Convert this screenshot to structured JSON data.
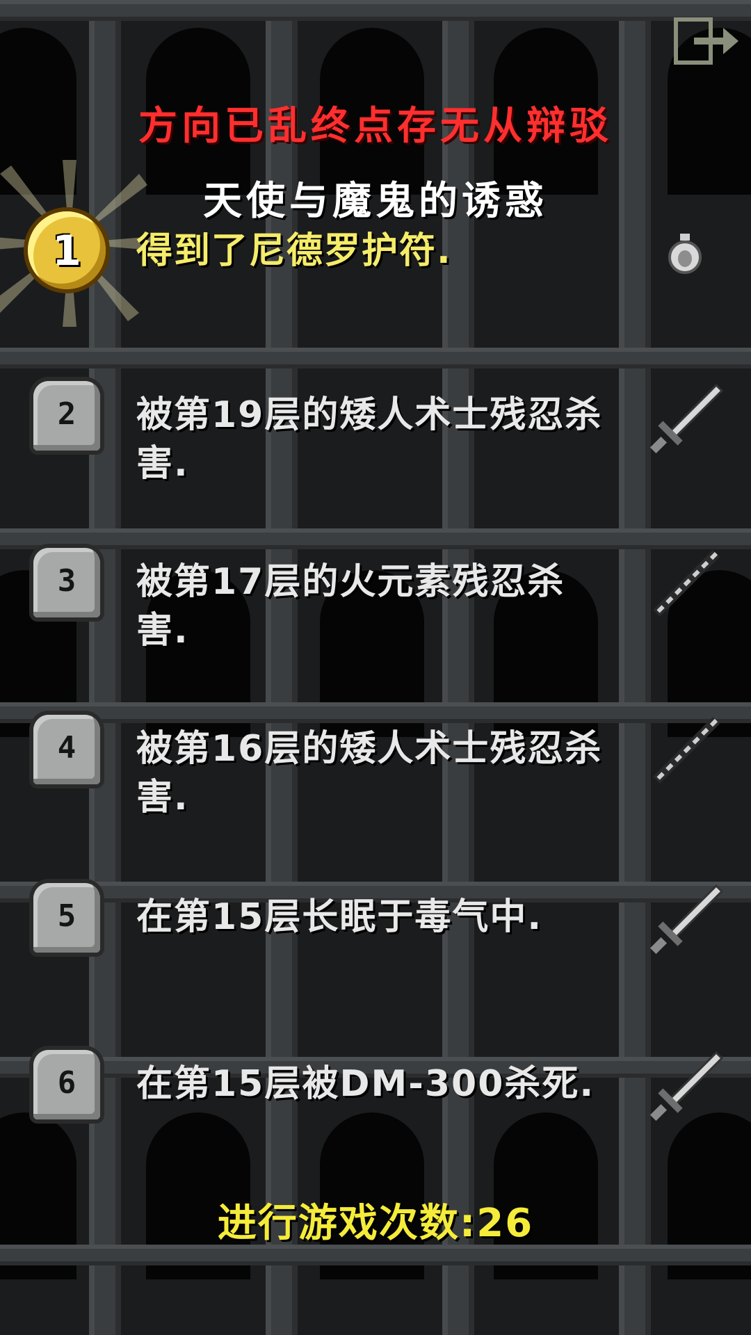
{
  "header": {
    "challenge_title": "方向已乱终点存无从辩驳",
    "badge_title": "天使与魔鬼的诱惑"
  },
  "records": [
    {
      "rank": "1",
      "text": "得到了尼德罗护符.",
      "icon": "amulet-icon"
    },
    {
      "rank": "2",
      "text": "被第19层的矮人术士残忍杀害.",
      "icon": "sword-icon"
    },
    {
      "rank": "3",
      "text": "被第17层的火元素残忍杀害.",
      "icon": "spear-icon"
    },
    {
      "rank": "4",
      "text": "被第16层的矮人术士残忍杀害.",
      "icon": "spear-icon"
    },
    {
      "rank": "5",
      "text": "在第15层长眠于毒气中.",
      "icon": "sword-icon"
    },
    {
      "rank": "6",
      "text": "在第15层被DM-300杀死.",
      "icon": "sword-icon"
    }
  ],
  "footer": {
    "games_played": "进行游戏次数:26"
  },
  "colors": {
    "title_red": "#ff2f2f",
    "gold_text": "#f5ec6a",
    "footer_yellow": "#f5ec3a",
    "text_light": "#e8e8e8"
  }
}
